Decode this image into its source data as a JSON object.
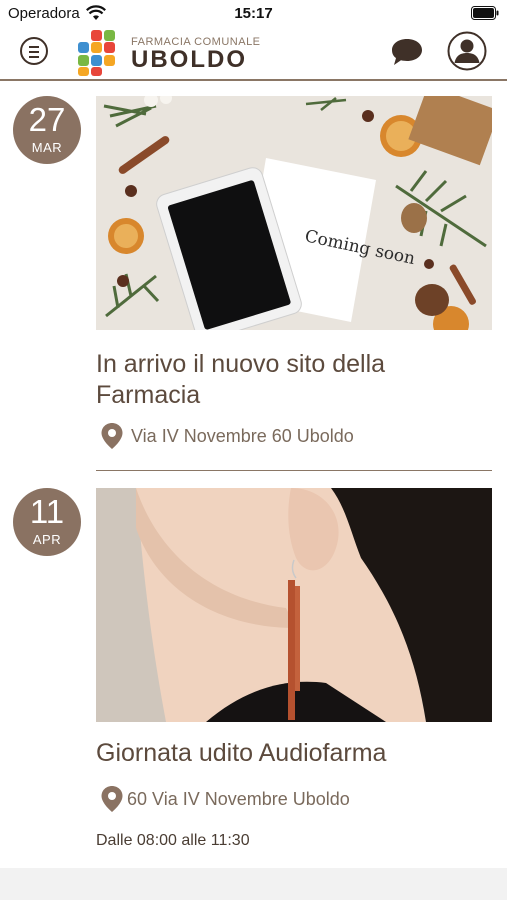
{
  "status_bar": {
    "carrier": "Operadora",
    "time": "15:17"
  },
  "header": {
    "logo_subtitle": "FARMACIA COMUNALE",
    "logo_title": "UBOLDO",
    "icons": [
      "menu-icon",
      "chat-icon",
      "profile-icon"
    ]
  },
  "events": [
    {
      "day": "27",
      "month": "MAR",
      "title": "In arrivo il nuovo sito della Farmacia",
      "location": "Via IV Novembre 60 Uboldo",
      "image_caption": "Coming soon"
    },
    {
      "day": "11",
      "month": "APR",
      "title": "Giornata udito Audiofarma",
      "location": "60 Via IV Novembre Uboldo",
      "hours": "Dalle 08:00 alle 11:30"
    }
  ],
  "colors": {
    "accent": "#8a7262",
    "text": "#5c4a3d",
    "divider": "#8a7665"
  }
}
